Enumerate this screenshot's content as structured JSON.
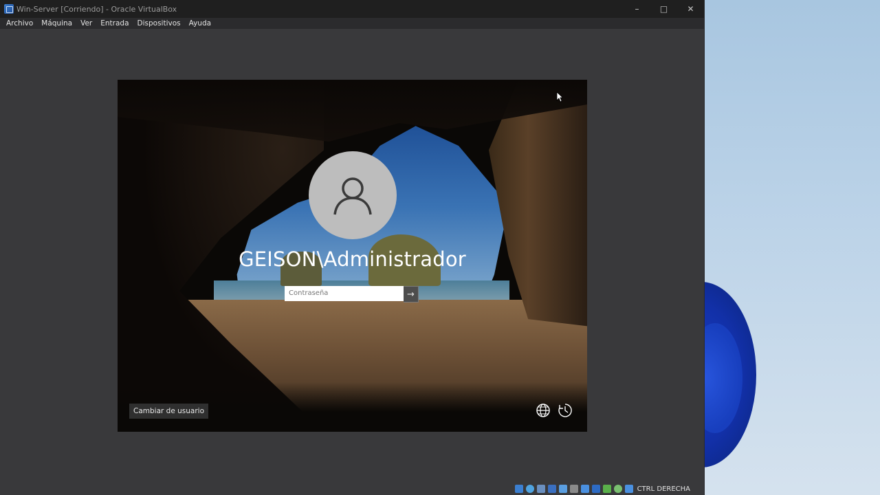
{
  "window": {
    "title": "Win-Server [Corriendo] - Oracle VirtualBox",
    "minimize_glyph": "–",
    "maximize_glyph": "□",
    "close_glyph": "✕"
  },
  "menu": {
    "items": [
      {
        "label": "Archivo"
      },
      {
        "label": "Máquina"
      },
      {
        "label": "Ver"
      },
      {
        "label": "Entrada"
      },
      {
        "label": "Dispositivos"
      },
      {
        "label": "Ayuda"
      }
    ]
  },
  "login": {
    "user_name": "GEISON\\Administrador",
    "password_placeholder": "Contraseña",
    "password_value": "",
    "submit_glyph": "→",
    "switch_user_label": "Cambiar de usuario",
    "icons": [
      "language-icon",
      "accessibility-icon"
    ]
  },
  "statusbar": {
    "icons": [
      "hard-disk-icon",
      "optical-drive-icon",
      "audio-icon",
      "network-icon",
      "usb-icon",
      "shared-folders-icon",
      "display-icon",
      "recording-icon",
      "cpu-icon",
      "mouse-integration-icon",
      "keyboard-icon"
    ],
    "host_key_label": "CTRL DERECHA"
  },
  "colors": {
    "accent_blue": "#1a3fc4",
    "titlebar_bg": "#1f1f1f",
    "window_bg": "#39393b"
  }
}
